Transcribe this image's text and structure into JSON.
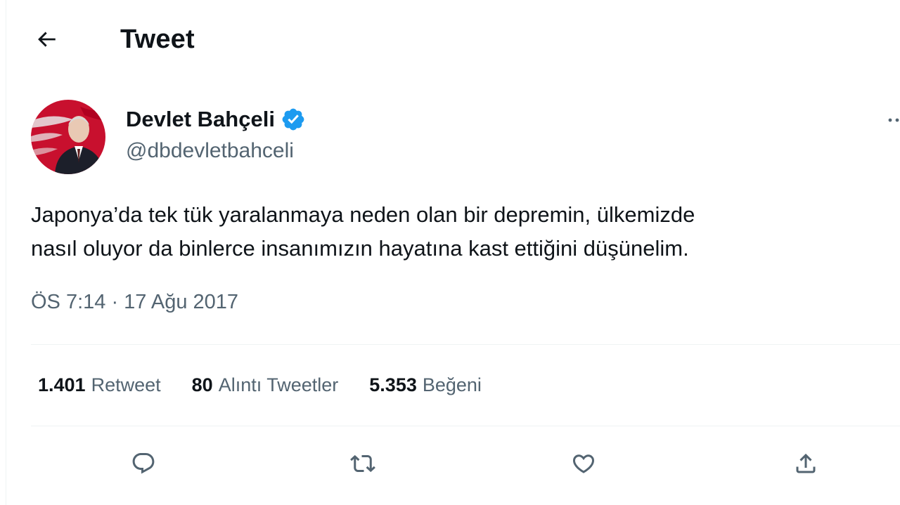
{
  "header": {
    "back_icon": "arrow-left-icon",
    "title": "Tweet"
  },
  "author": {
    "name": "Devlet Bahçeli",
    "handle": "@dbdevletbahceli",
    "verified": true,
    "verified_icon": "verified-badge-icon",
    "verified_color": "#1d9bf0",
    "avatar_icon": "profile-avatar"
  },
  "more_icon": "more-horizontal-icon",
  "tweet": {
    "text": "Japonya’da tek tük yaralanmaya neden olan bir depremin, ülkemizde\nnasıl oluyor da binlerce insanımızın hayatına kast ettiğini düşünelim.",
    "timestamp": "ÖS 7:14 · 17 Ağu 2017"
  },
  "stats": [
    {
      "count": "1.401",
      "label": "Retweet"
    },
    {
      "count": "80",
      "label": "Alıntı Tweetler"
    },
    {
      "count": "5.353",
      "label": "Beğeni"
    }
  ],
  "actions": [
    {
      "icon": "reply-icon"
    },
    {
      "icon": "retweet-icon"
    },
    {
      "icon": "like-heart-icon"
    },
    {
      "icon": "share-icon"
    }
  ],
  "colors": {
    "text_primary": "#0f1419",
    "text_secondary": "#536471",
    "divider": "#eff3f4",
    "accent": "#1d9bf0"
  }
}
